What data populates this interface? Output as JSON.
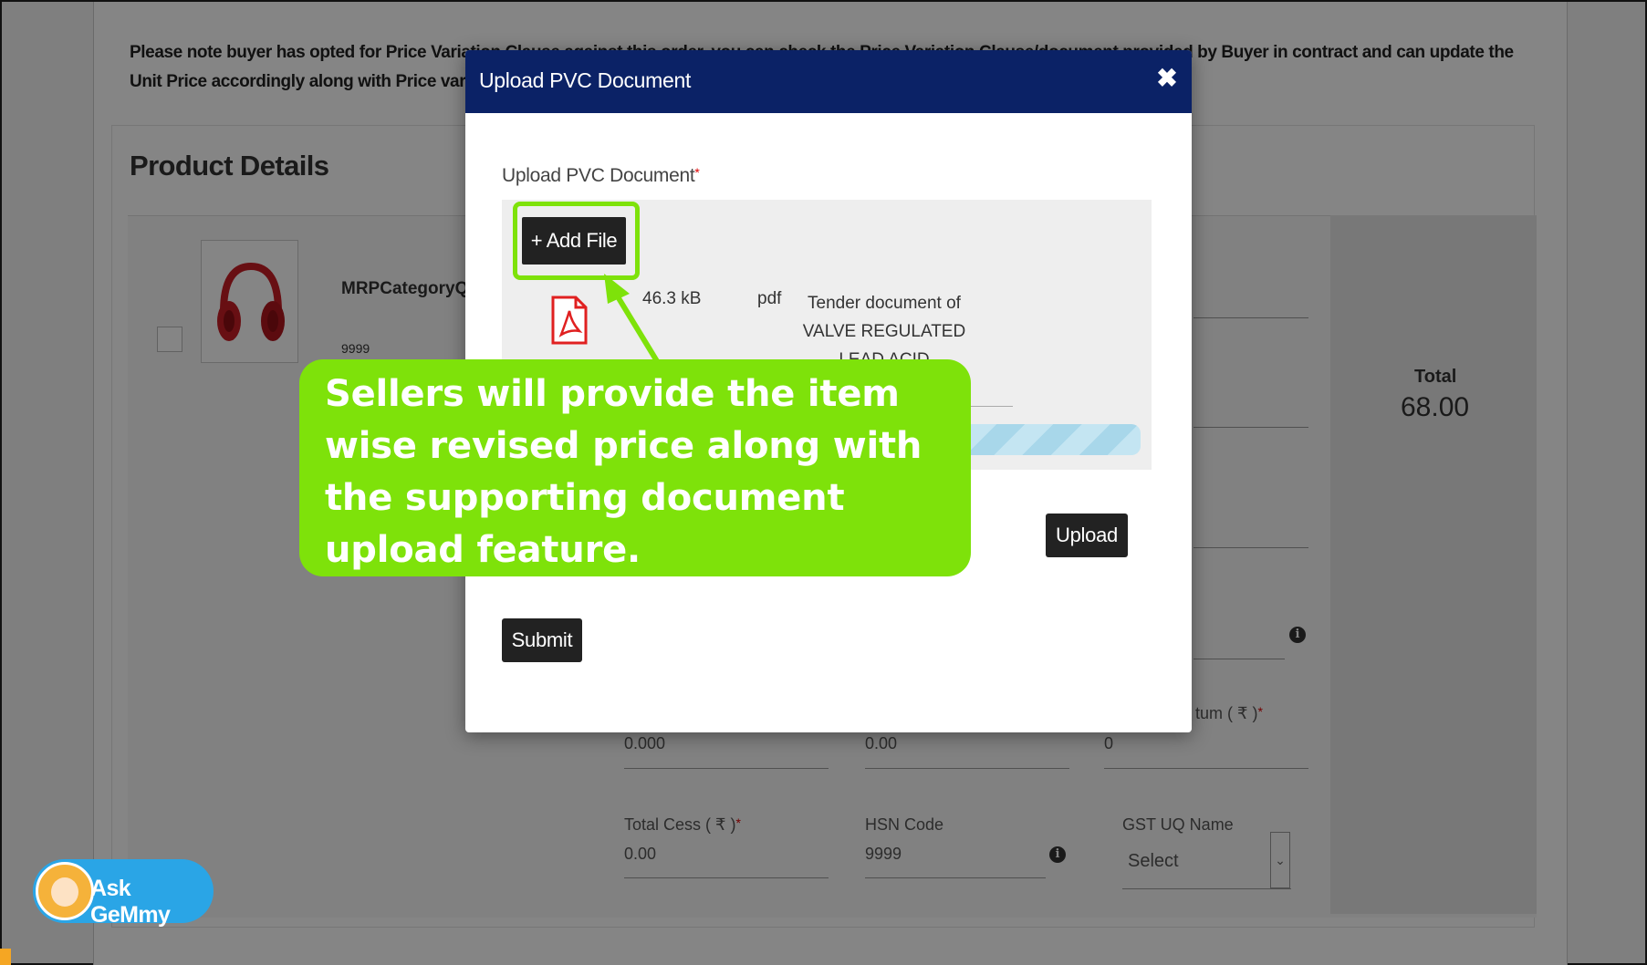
{
  "notice_text": "Please note buyer has opted for Price Variation Clause against this order, you can check the Price Variation Clause/document provided by Buyer in contract and can update the Unit Price accordingly along with Price variation clause document.",
  "product": {
    "section_title": "Product Details",
    "name": "MRPCategoryQ3",
    "code": "9999",
    "total_label": "Total",
    "total_value": "68.00"
  },
  "bg_fields": {
    "value_a": "0.000",
    "value_b": "0.00",
    "value_c": "0",
    "partial_label": "tum ( ₹ )",
    "cess_label": "Total Cess ( ₹ )",
    "cess_value": "0.00",
    "hsn_label": "HSN Code",
    "hsn_value": "9999",
    "gst_label": "GST UQ Name",
    "gst_value": "Select",
    "asterisk": "*"
  },
  "modal": {
    "title": "Upload PVC Document",
    "close_glyph": "✖",
    "field_label": "Upload PVC Document",
    "required_mark": "*",
    "add_file_label": "+ Add File",
    "file": {
      "size": "46.3 kB",
      "type": "pdf",
      "name": "Tender document of VALVE REGULATED LEAD ACID BATTERIES 120AH .pdf"
    },
    "upload_label": "Upload",
    "submit_label": "Submit"
  },
  "callout": {
    "text": "Sellers will provide the item wise revised price along with the supporting document upload feature.",
    "color": "#7ee20a"
  },
  "assistant": {
    "label": "Ask GeMmy",
    "color": "#2aa5e6"
  },
  "colors": {
    "header": "#0b2266",
    "button": "#222222",
    "highlight": "#7ee20a"
  }
}
